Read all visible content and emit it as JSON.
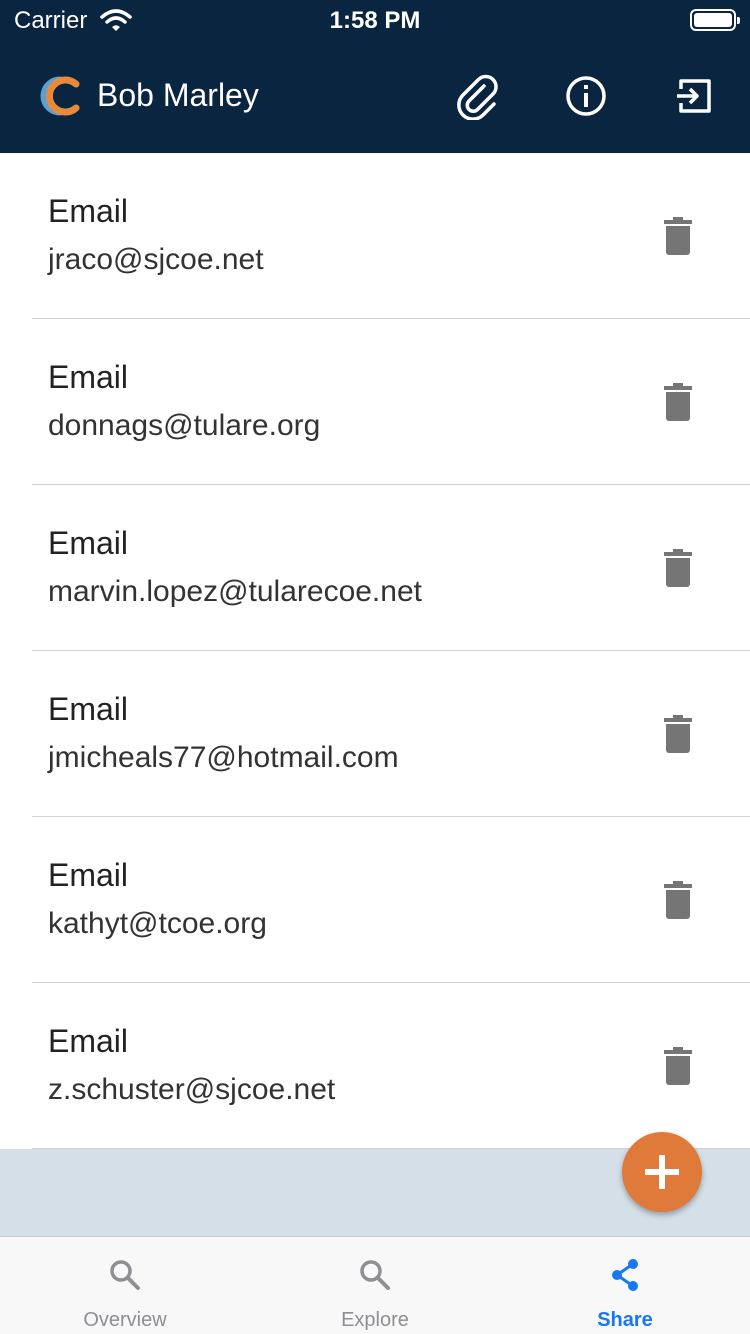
{
  "status_bar": {
    "carrier": "Carrier",
    "time": "1:58 PM"
  },
  "header": {
    "title": "Bob Marley",
    "icons": [
      "logo",
      "paperclip-icon",
      "info-icon",
      "exit-icon"
    ],
    "background": "#0a2540"
  },
  "contacts": [
    {
      "label": "Email",
      "value": "jraco@sjcoe.net"
    },
    {
      "label": "Email",
      "value": "donnags@tulare.org"
    },
    {
      "label": "Email",
      "value": "marvin.lopez@tularecoe.net"
    },
    {
      "label": "Email",
      "value": "jmicheals77@hotmail.com"
    },
    {
      "label": "Email",
      "value": "kathyt@tcoe.org"
    },
    {
      "label": "Email",
      "value": "z.schuster@sjcoe.net"
    }
  ],
  "fab": {
    "icon": "plus-icon",
    "color": "#e07a3a"
  },
  "tabs": [
    {
      "label": "Overview",
      "icon": "search-icon",
      "active": false
    },
    {
      "label": "Explore",
      "icon": "search-icon",
      "active": false
    },
    {
      "label": "Share",
      "icon": "share-icon",
      "active": true
    }
  ],
  "colors": {
    "accent": "#1877f2",
    "inactive": "#8e8e93",
    "band": "#d4dfe7"
  }
}
